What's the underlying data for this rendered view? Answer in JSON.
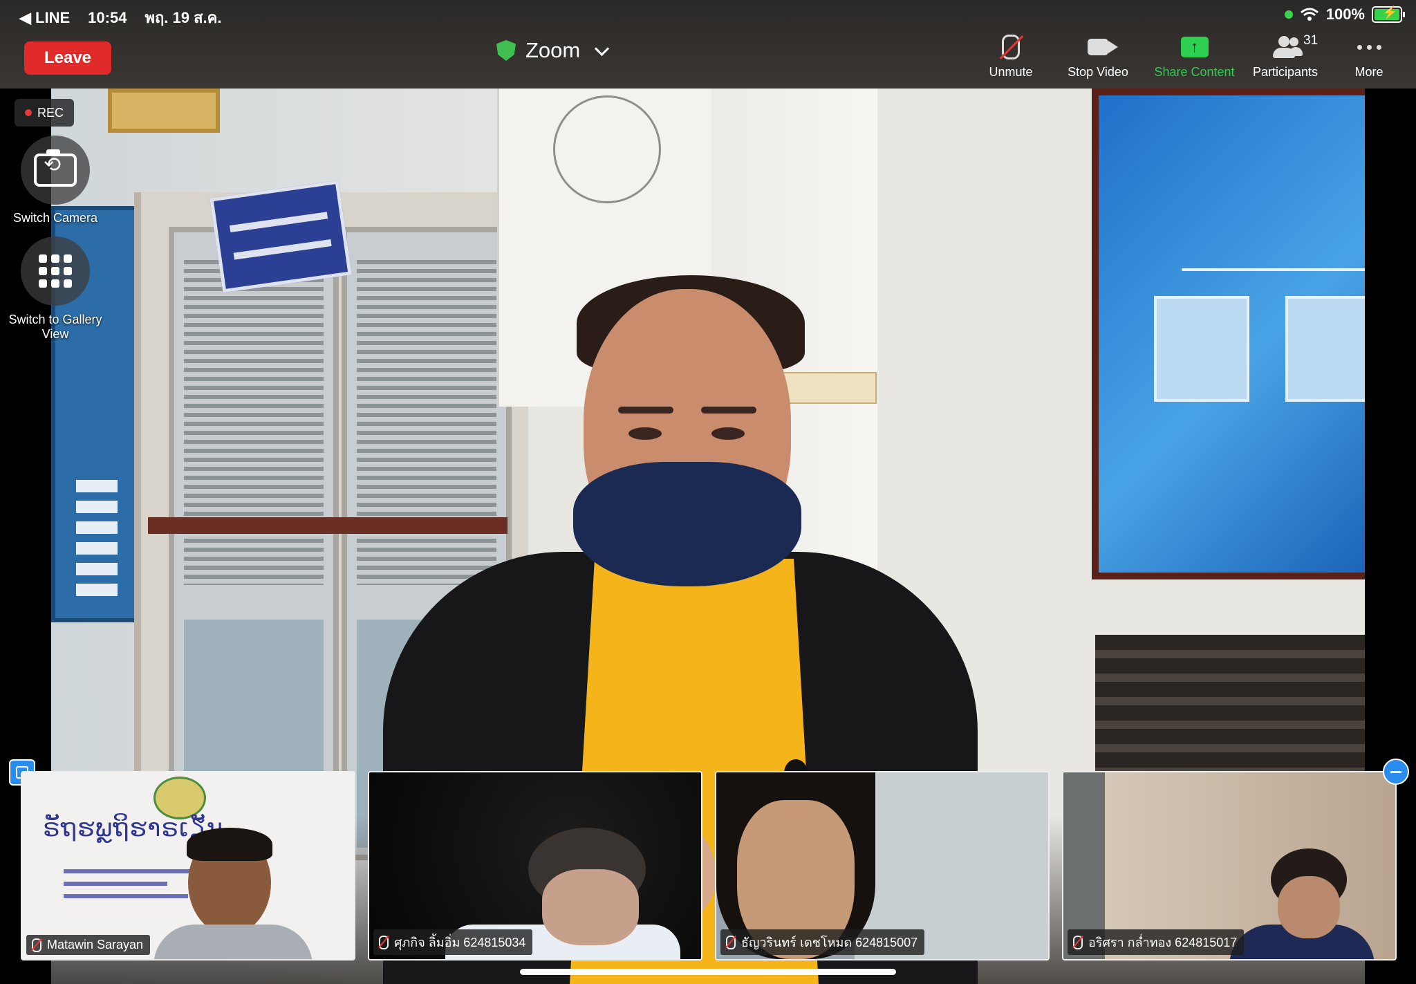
{
  "status_bar": {
    "back_app": "◀ LINE",
    "time": "10:54",
    "date": "พฤ. 19 ส.ค.",
    "battery": "100%"
  },
  "meeting": {
    "leave_label": "Leave",
    "title": "Zoom"
  },
  "toolbar": {
    "unmute": "Unmute",
    "stop_video": "Stop Video",
    "share_content": "Share Content",
    "participants": "Participants",
    "participants_count": "31",
    "more": "More"
  },
  "left_panel": {
    "rec": "REC",
    "switch_camera": "Switch Camera",
    "gallery_view": "Switch to Gallery View"
  },
  "thumbnails": [
    {
      "name": "Matawin Sarayan"
    },
    {
      "name": "ศุภกิจ ลิ้มอิ่ม 624815034"
    },
    {
      "name": "ธัญวรินทร์ เดชโหมด 624815007"
    },
    {
      "name": "อริศรา กล่ำทอง 624815017"
    }
  ],
  "colors": {
    "leave_red": "#e12a2a",
    "share_green": "#2ccf4f",
    "accent_blue": "#2b8cf0"
  }
}
